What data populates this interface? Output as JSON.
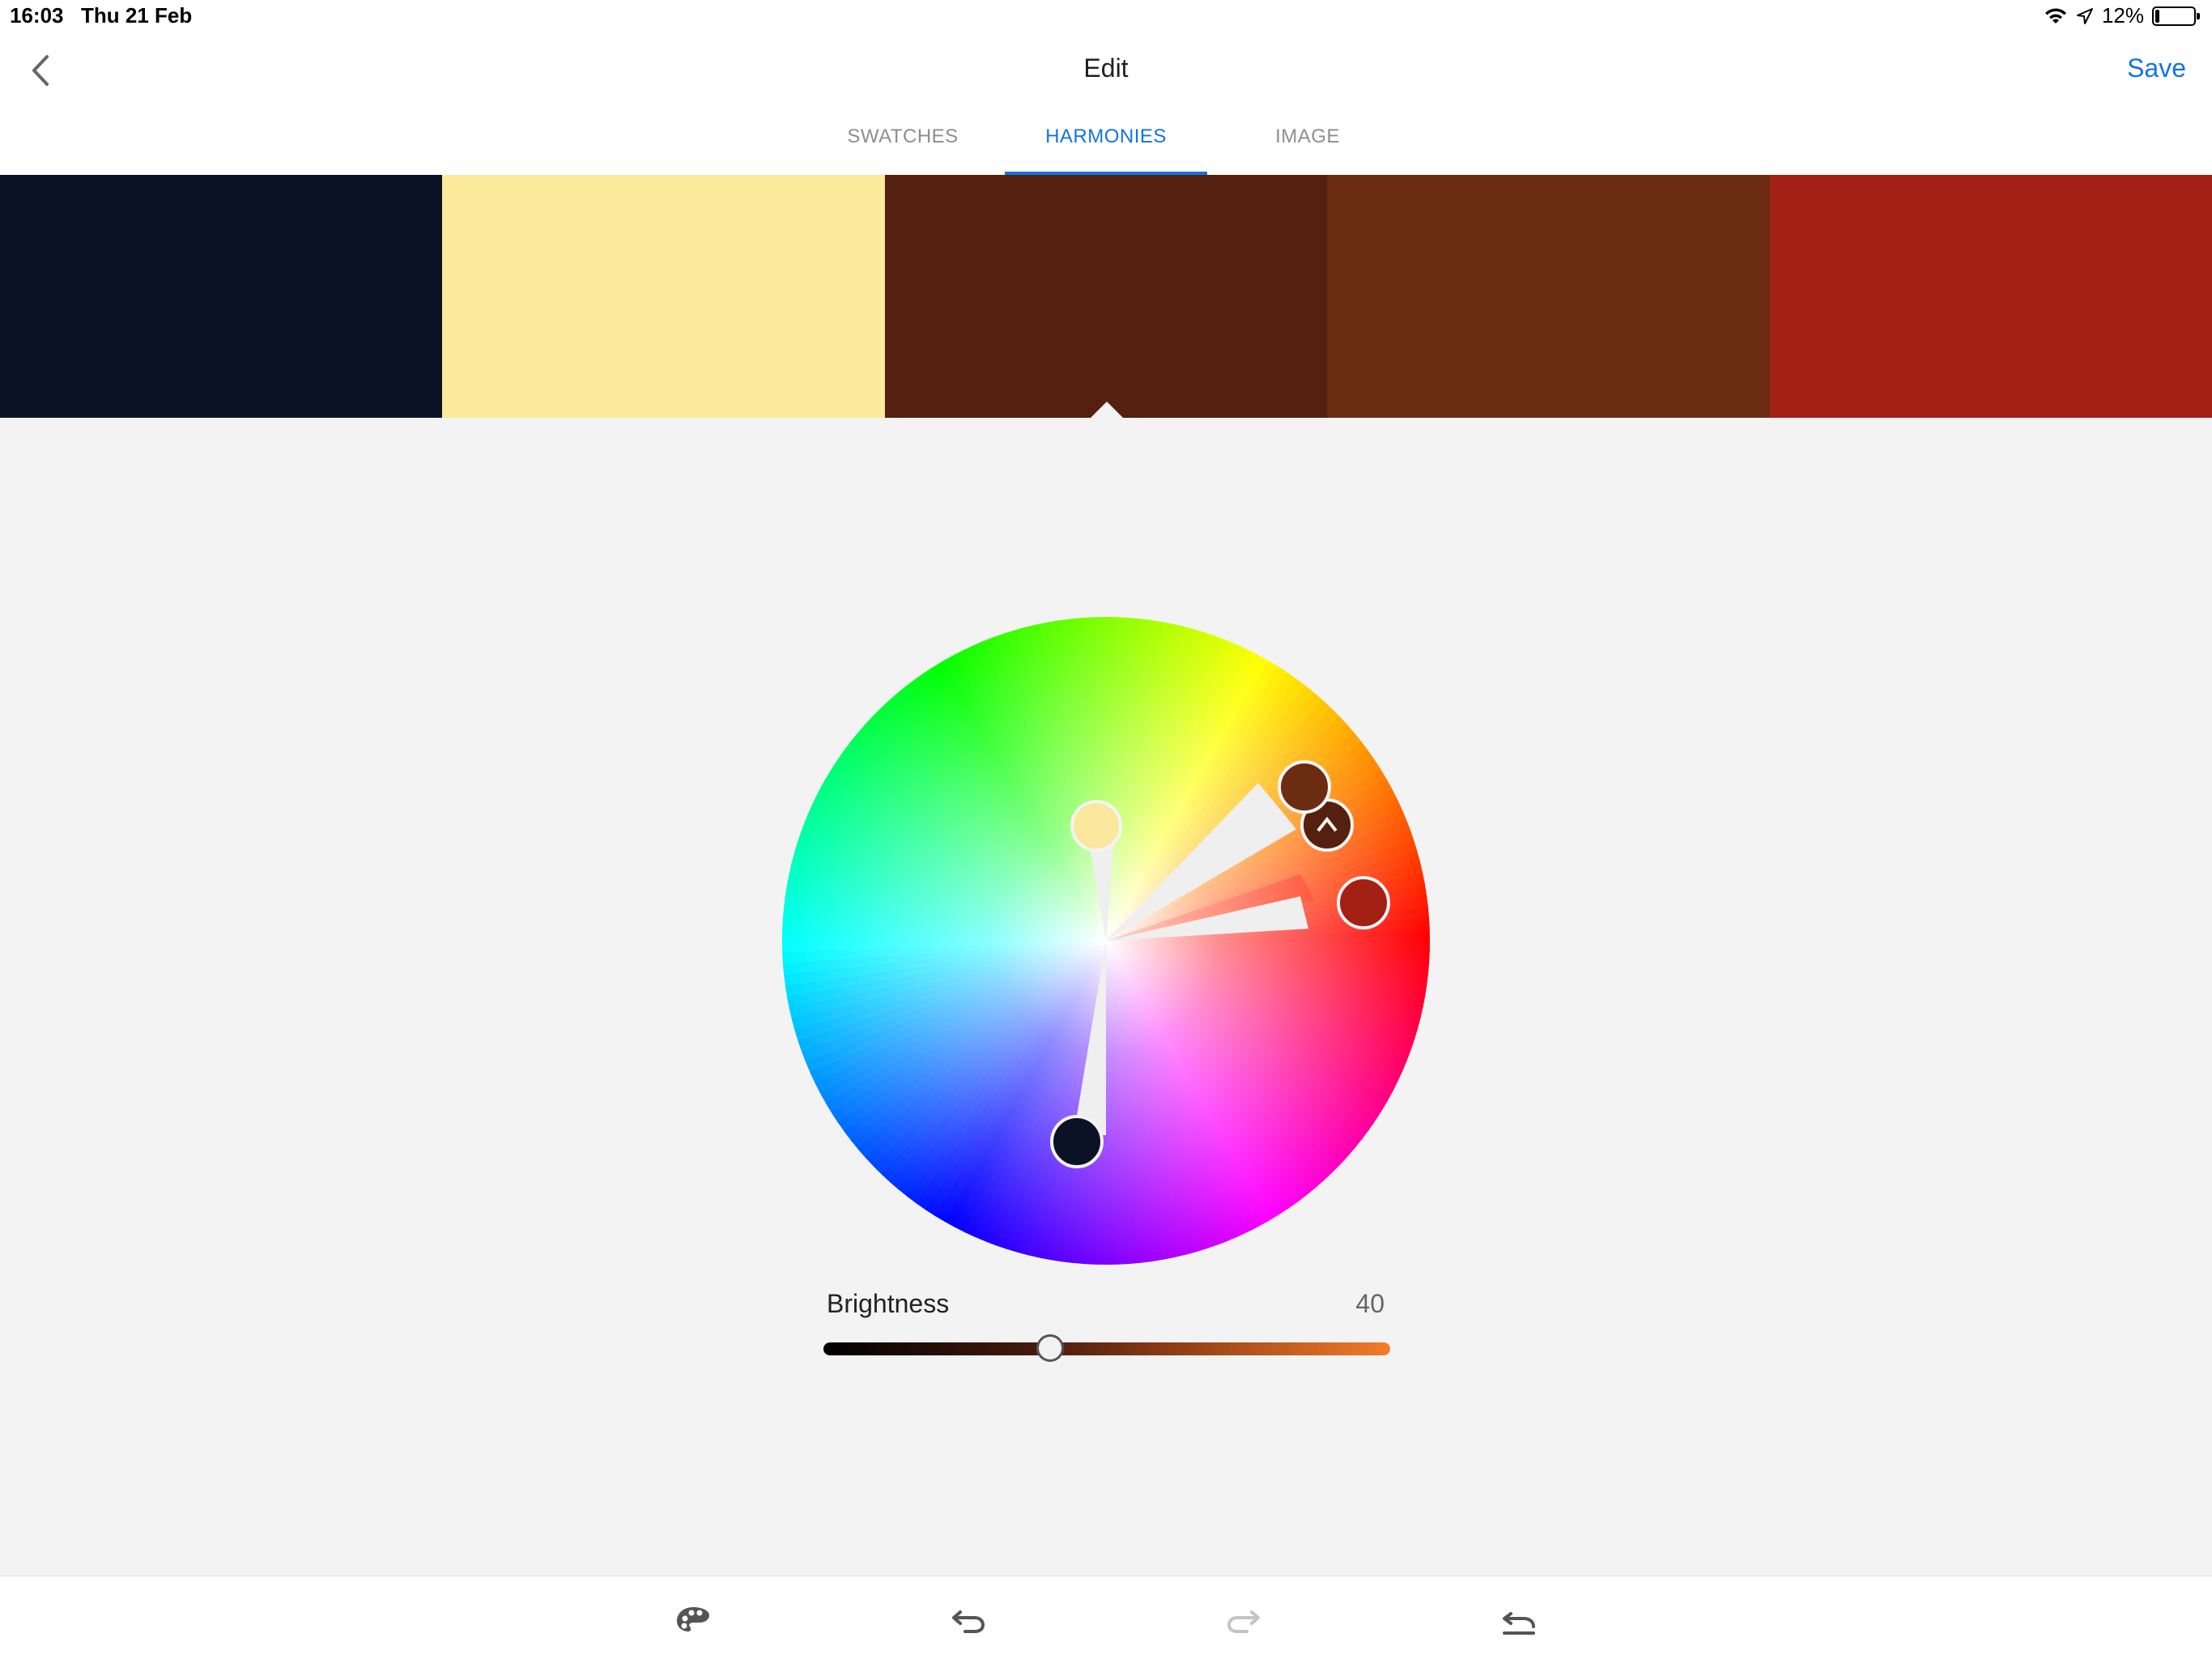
{
  "status_bar": {
    "time": "16:03",
    "date": "Thu 21 Feb",
    "battery": "12%",
    "battery_level": 0.12
  },
  "header": {
    "title": "Edit",
    "save_label": "Save",
    "back_icon": "chevron-left-icon"
  },
  "tabs": [
    {
      "label": "SWATCHES",
      "active": false
    },
    {
      "label": "HARMONIES",
      "active": true
    },
    {
      "label": "IMAGE",
      "active": false
    }
  ],
  "swatches": [
    {
      "color": "#0c1226"
    },
    {
      "color": "#fbe99c"
    },
    {
      "color": "#55200f",
      "selected": true
    },
    {
      "color": "#6b2c12"
    },
    {
      "color": "#a32015"
    }
  ],
  "brightness": {
    "label": "Brightness",
    "value": "40",
    "level": 0.4
  },
  "toolbar": {
    "icons": [
      "palette-icon",
      "undo-icon",
      "redo-icon",
      "revert-icon"
    ]
  },
  "colors": {
    "accent": "#1473e6"
  }
}
